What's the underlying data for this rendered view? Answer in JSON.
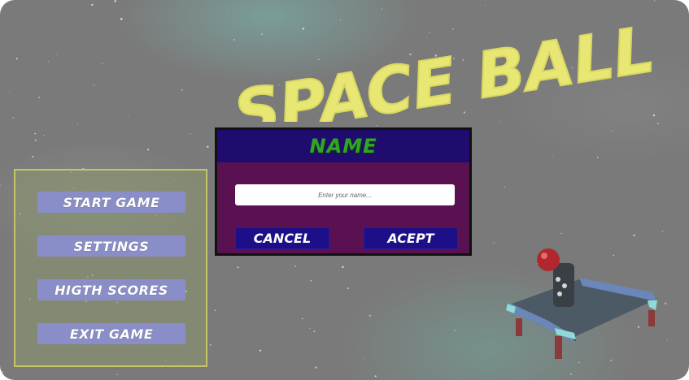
{
  "title": "SPACE BALL",
  "dialog": {
    "title": "NAME",
    "input_placeholder": "Enter your name...",
    "input_value": "",
    "cancel_label": "CANCEL",
    "accept_label": "ACEPT"
  },
  "menu": {
    "items": [
      {
        "label": "START GAME"
      },
      {
        "label": "SETTINGS"
      },
      {
        "label": "HIGTH SCORES"
      },
      {
        "label": "EXIT GAME"
      }
    ]
  },
  "colors": {
    "title": "#e8e773",
    "dialog_header": "#1f0c6e",
    "dialog_body": "#5a1151",
    "dialog_title": "#2fa624",
    "dialog_button": "#1c0f87",
    "menu_button": "#8a8ec8",
    "menu_border": "#c7c465"
  }
}
